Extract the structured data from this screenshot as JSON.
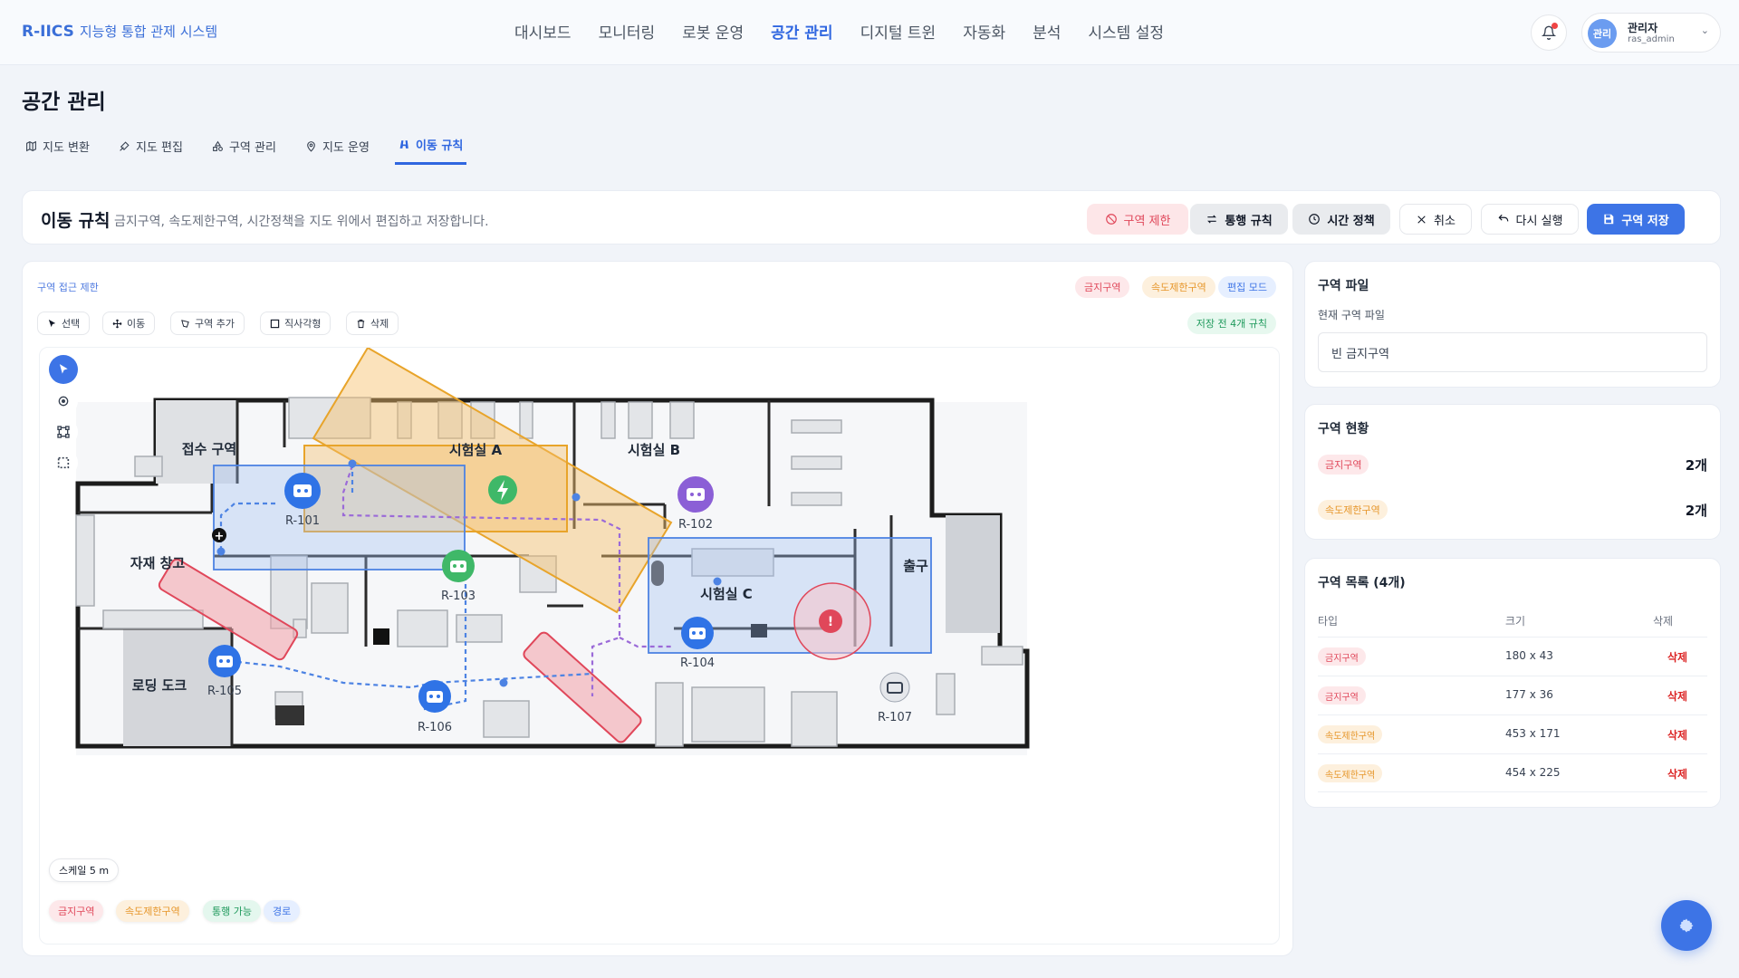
{
  "header": {
    "brand": "R-IICS",
    "brand_sub": "지능형 통합 관제 시스템",
    "nav": [
      "대시보드",
      "모니터링",
      "로봇 운영",
      "공간 관리",
      "디지털 트윈",
      "자동화",
      "분석",
      "시스템 설정"
    ],
    "active_nav": "공간 관리",
    "user": {
      "avatar_text": "관리",
      "name": "관리자",
      "id": "ras_admin"
    }
  },
  "page": {
    "title": "공간 관리"
  },
  "tabs": [
    {
      "label": "지도 변환",
      "icon": "map-icon"
    },
    {
      "label": "지도 편집",
      "icon": "edit-tools-icon"
    },
    {
      "label": "구역 관리",
      "icon": "shapes-icon"
    },
    {
      "label": "지도 운영",
      "icon": "pin-icon"
    },
    {
      "label": "이동 규칙",
      "icon": "route-icon",
      "active": true
    }
  ],
  "rule_panel": {
    "title": "이동 규칙",
    "description": "금지구역, 속도제한구역, 시간정책을 지도 위에서 편집하고 저장합니다.",
    "buttons": {
      "restrict": "구역 제한",
      "traffic": "통행 규칙",
      "time": "시간 정책",
      "cancel": "취소",
      "redo": "다시 실행",
      "save": "구역 저장"
    }
  },
  "map": {
    "section_label": "구역 접근 제한",
    "legend_top": [
      "금지구역",
      "속도제한구역",
      "편집 모드"
    ],
    "pending": "저장 전 4개 규칙",
    "tools": [
      "선택",
      "이동",
      "구역 추가",
      "직사각형",
      "삭제"
    ],
    "rooms": {
      "reception": "접수 구역",
      "lab_a": "시험실 A",
      "lab_b": "시험실 B",
      "lab_c": "시험실 C",
      "storage": "자재 창고",
      "loading": "로딩 도크",
      "exit": "출구"
    },
    "robots": [
      "R-101",
      "R-102",
      "R-103",
      "R-104",
      "R-105",
      "R-106",
      "R-107"
    ],
    "scale": "스케일 5 m",
    "legend_bottom": [
      "금지구역",
      "속도제한구역",
      "통행 가능",
      "경로"
    ]
  },
  "zone_file": {
    "title": "구역 파일",
    "label": "현재 구역 파일",
    "value": "빈 금지구역"
  },
  "zone_status": {
    "title": "구역 현황",
    "rows": [
      {
        "type": "금지구역",
        "count": "2개"
      },
      {
        "type": "속도제한구역",
        "count": "2개"
      }
    ]
  },
  "zone_list": {
    "title": "구역 목록 (4개)",
    "headers": [
      "타입",
      "크기",
      "삭제"
    ],
    "rows": [
      {
        "type": "금지구역",
        "size": "180 x 43",
        "action": "삭제"
      },
      {
        "type": "금지구역",
        "size": "177 x 36",
        "action": "삭제"
      },
      {
        "type": "속도제한구역",
        "size": "453 x 171",
        "action": "삭제"
      },
      {
        "type": "속도제한구역",
        "size": "454 x 225",
        "action": "삭제"
      }
    ]
  },
  "colors": {
    "accent": "#3d74e6",
    "forbidden": "#e0475a",
    "speed_limit": "#e6962a",
    "passable": "#1f9a5c"
  }
}
